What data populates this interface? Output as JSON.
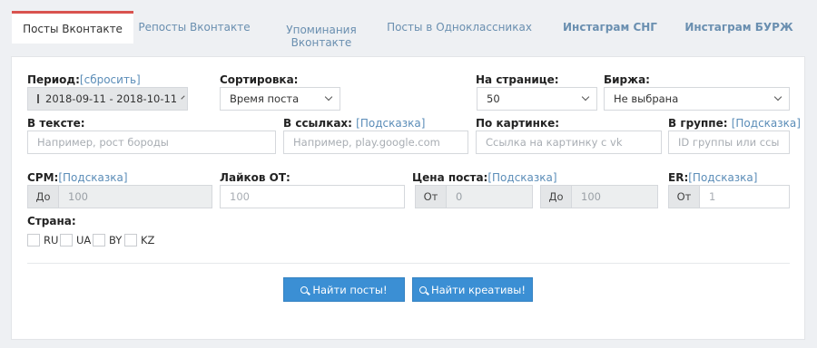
{
  "tabs": [
    {
      "label": "Посты Вконтакте"
    },
    {
      "label": "Репосты Вконтакте"
    },
    {
      "label": "Упоминания Вконтакте"
    },
    {
      "label": "Посты в Одноклассниках"
    },
    {
      "label": "Инстаграм СНГ"
    },
    {
      "label": "Инстаграм БУРЖ"
    }
  ],
  "filters": {
    "period": {
      "label": "Период:",
      "reset": "[сбросить]",
      "value": "2018-09-11 - 2018-10-11"
    },
    "sort": {
      "label": "Сортировка:",
      "value": "Время поста"
    },
    "per_page": {
      "label": "На странице:",
      "value": "50"
    },
    "exchange": {
      "label": "Биржа:",
      "value": "Не выбрана"
    },
    "text": {
      "label": "В тексте:",
      "placeholder": "Например, рост бороды"
    },
    "links": {
      "label": "В ссылках:",
      "hint": "[Подсказка]",
      "placeholder": "Например, play.google.com"
    },
    "picture": {
      "label": "По картинке:",
      "placeholder": "Ссылка на картинку с vk"
    },
    "group": {
      "label": "В группе:",
      "hint": "[Подсказка]",
      "placeholder": "ID группы или ссы"
    },
    "cpm": {
      "label": "CPM:",
      "hint": "[Подсказка]",
      "addon": "До",
      "placeholder": "100"
    },
    "likes": {
      "label": "Лайков ОТ:",
      "placeholder": "100"
    },
    "price": {
      "label": "Цена поста:",
      "hint": "[Подсказка]",
      "from_addon": "От",
      "from_placeholder": "0",
      "to_addon": "До",
      "to_placeholder": "100"
    },
    "er": {
      "label": "ER:",
      "hint": "[Подсказка]",
      "addon": "От",
      "placeholder": "1"
    },
    "country": {
      "label": "Страна:",
      "options": [
        "RU",
        "UA",
        "BY",
        "KZ"
      ]
    }
  },
  "buttons": {
    "find_posts": "Найти посты!",
    "find_creatives": "Найти креативы!"
  },
  "colors": {
    "accent": "#3b8fd4",
    "active_tab_border": "#d9534f",
    "hint": "#5b8db8"
  }
}
